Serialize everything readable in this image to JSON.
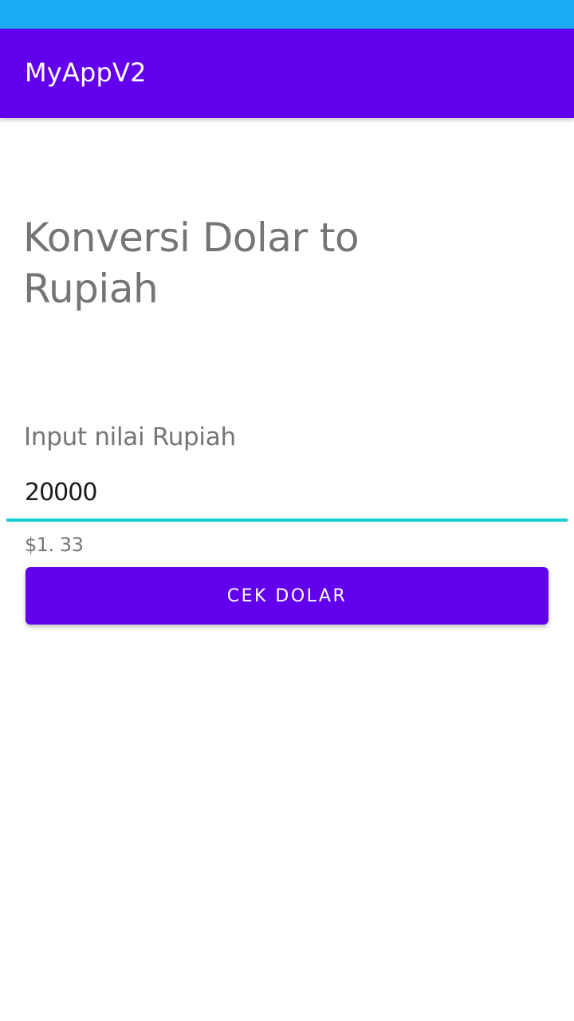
{
  "app_bar": {
    "title": "MyAppV2"
  },
  "main": {
    "heading": "Konversi Dolar to Rupiah",
    "input_label": "Input nilai Rupiah",
    "input_value": "20000",
    "result": "$1. 33",
    "button_label": "CEK DOLAR"
  },
  "colors": {
    "status_bar": "#1aabf3",
    "primary": "#6200ee",
    "input_underline": "#19cfcd",
    "secondary_text": "#757575"
  }
}
